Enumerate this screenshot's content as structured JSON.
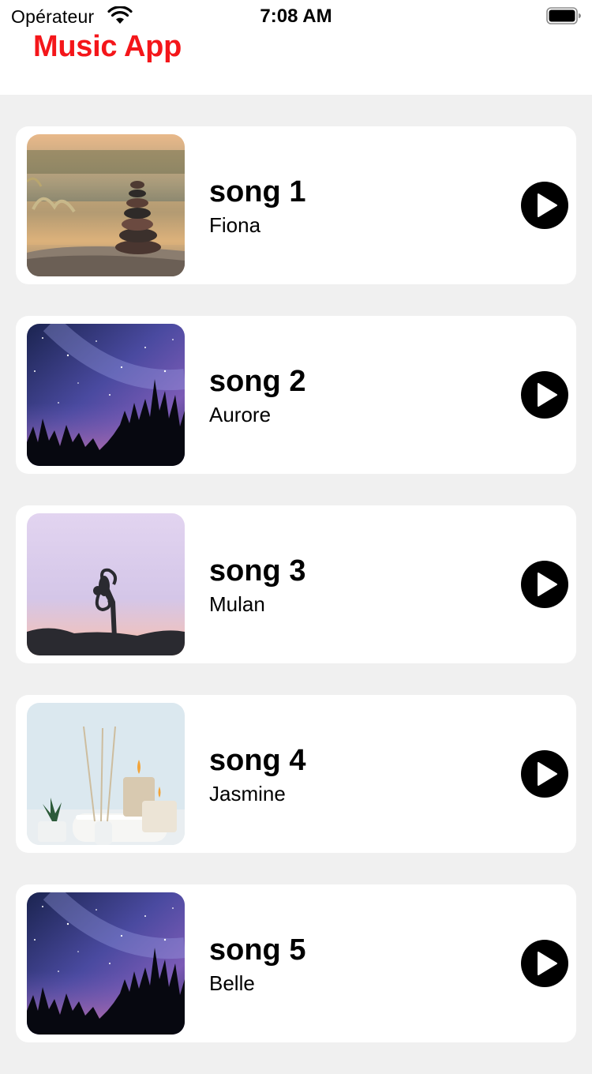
{
  "status_bar": {
    "carrier": "Opérateur",
    "time": "7:08 AM",
    "wifi_icon": "wifi-icon",
    "battery_icon": "battery-full-icon"
  },
  "header": {
    "title": "Music App",
    "title_color": "#f4161a"
  },
  "songs": [
    {
      "title": "song 1",
      "artist": "Fiona",
      "artwork": "zen-stones"
    },
    {
      "title": "song 2",
      "artist": "Aurore",
      "artwork": "starry-sky"
    },
    {
      "title": "song 3",
      "artist": "Mulan",
      "artwork": "yoga-silhouette"
    },
    {
      "title": "song 4",
      "artist": "Jasmine",
      "artwork": "spa-candles"
    },
    {
      "title": "song 5",
      "artist": "Belle",
      "artwork": "starry-sky"
    }
  ],
  "colors": {
    "background": "#f0f0f0",
    "card": "#ffffff",
    "play_button": "#000000"
  }
}
